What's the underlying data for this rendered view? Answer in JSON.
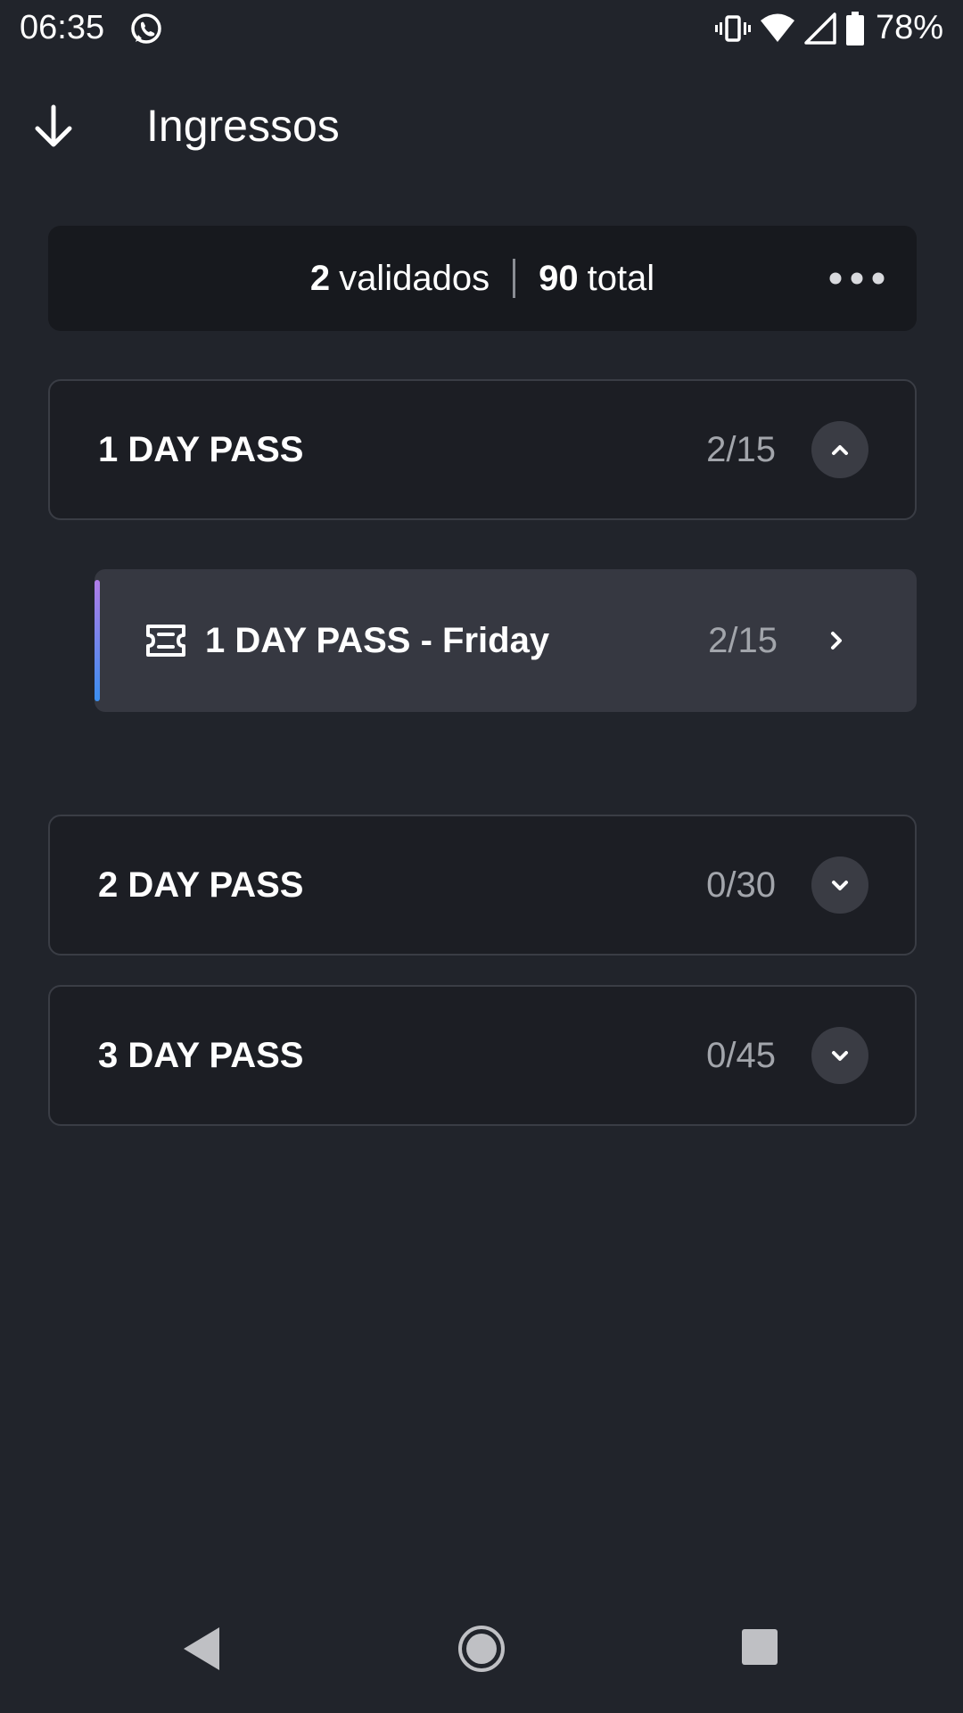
{
  "status_bar": {
    "time": "06:35",
    "battery": "78%",
    "icons": [
      "whatsapp-icon",
      "vibrate-icon",
      "wifi-icon",
      "signal-icon",
      "battery-icon"
    ]
  },
  "header": {
    "title": "Ingressos",
    "back_icon": "arrow-down-icon"
  },
  "summary": {
    "validated_count": "2",
    "validated_label": "validados",
    "total_count": "90",
    "total_label": "total",
    "more_icon": "more-horizontal-icon"
  },
  "passes": [
    {
      "title": "1 DAY PASS",
      "count": "2/15",
      "expanded": true,
      "items": [
        {
          "title": "1 DAY PASS - Friday",
          "count": "2/15",
          "icon": "ticket-icon"
        }
      ]
    },
    {
      "title": "2 DAY PASS",
      "count": "0/30",
      "expanded": false
    },
    {
      "title": "3 DAY PASS",
      "count": "0/45",
      "expanded": false
    }
  ],
  "colors": {
    "background": "#21242b",
    "summary_bg": "#17191e",
    "card_bg": "#1c1e24",
    "subitem_bg": "#363841",
    "accent_top": "#b07ce8",
    "accent_bottom": "#3a8ef0",
    "muted_text": "#a2a5ab"
  }
}
